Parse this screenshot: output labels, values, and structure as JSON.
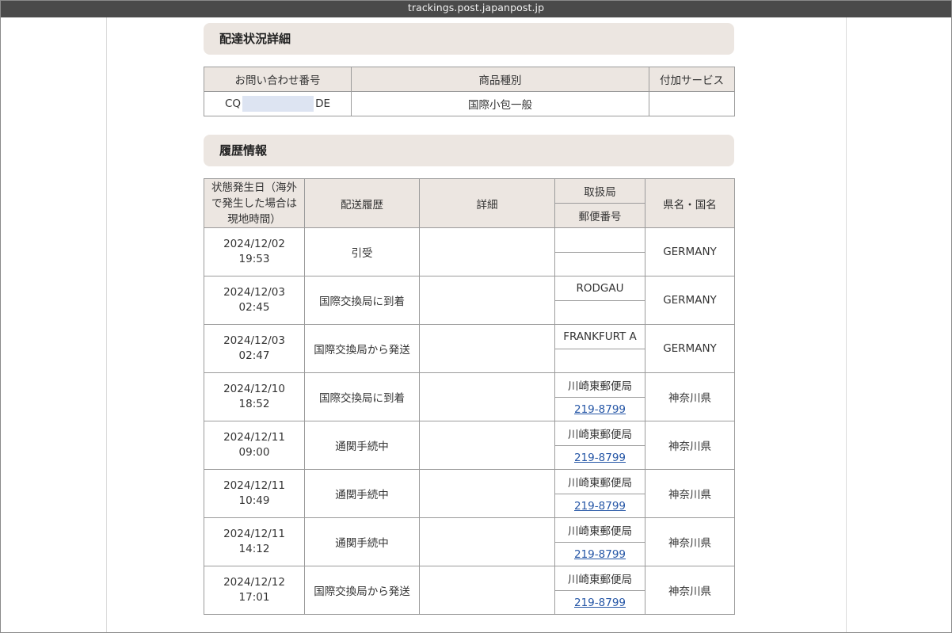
{
  "browser": {
    "url": "trackings.post.japanpost.jp"
  },
  "delivery": {
    "section_title": "配達状況詳細",
    "headers": {
      "tracking_number": "お問い合わせ番号",
      "item_type": "商品種別",
      "extra_service": "付加サービス"
    },
    "tracking_prefix": "CQ",
    "tracking_suffix": "DE",
    "item_type": "国際小包一般",
    "extra_service": ""
  },
  "history": {
    "section_title": "履歴情報",
    "headers": {
      "date": "状態発生日（海外で発生した場合は現地時間）",
      "date_lines": [
        "状態発生日（海外",
        "で発生した場合は",
        "現地時間）"
      ],
      "status": "配送履歴",
      "detail": "詳細",
      "office": "取扱局",
      "postal_code": "郵便番号",
      "region": "県名・国名"
    },
    "rows": [
      {
        "date": "2024/12/02",
        "time": "19:53",
        "status": "引受",
        "detail": "",
        "office": "",
        "postal_code": "",
        "region": "GERMANY"
      },
      {
        "date": "2024/12/03",
        "time": "02:45",
        "status": "国際交換局に到着",
        "detail": "",
        "office": "RODGAU",
        "postal_code": "",
        "region": "GERMANY"
      },
      {
        "date": "2024/12/03",
        "time": "02:47",
        "status": "国際交換局から発送",
        "detail": "",
        "office": "FRANKFURT A",
        "postal_code": "",
        "region": "GERMANY"
      },
      {
        "date": "2024/12/10",
        "time": "18:52",
        "status": "国際交換局に到着",
        "detail": "",
        "office": "川崎東郵便局",
        "postal_code": "219-8799",
        "region": "神奈川県"
      },
      {
        "date": "2024/12/11",
        "time": "09:00",
        "status": "通関手続中",
        "detail": "",
        "office": "川崎東郵便局",
        "postal_code": "219-8799",
        "region": "神奈川県"
      },
      {
        "date": "2024/12/11",
        "time": "10:49",
        "status": "通関手続中",
        "detail": "",
        "office": "川崎東郵便局",
        "postal_code": "219-8799",
        "region": "神奈川県"
      },
      {
        "date": "2024/12/11",
        "time": "14:12",
        "status": "通関手続中",
        "detail": "",
        "office": "川崎東郵便局",
        "postal_code": "219-8799",
        "region": "神奈川県"
      },
      {
        "date": "2024/12/12",
        "time": "17:01",
        "status": "国際交換局から発送",
        "detail": "",
        "office": "川崎東郵便局",
        "postal_code": "219-8799",
        "region": "神奈川県"
      }
    ]
  }
}
